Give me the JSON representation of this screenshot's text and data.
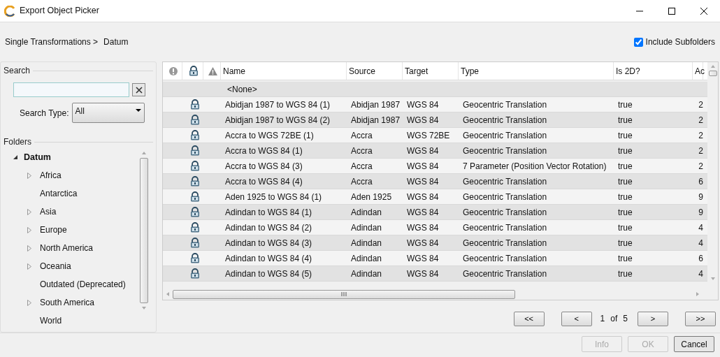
{
  "window": {
    "title": "Export Object Picker"
  },
  "breadcrumb": [
    "Single Transformations >",
    "Datum"
  ],
  "include_subfolders": {
    "label": "Include Subfolders",
    "checked": true
  },
  "search": {
    "title": "Search",
    "type_label": "Search Type:",
    "type_value": "All"
  },
  "folders": {
    "title": "Folders",
    "tree": [
      {
        "label": "Datum",
        "expanded": true,
        "children": [
          {
            "label": "Africa",
            "expandable": true
          },
          {
            "label": "Antarctica",
            "expandable": false
          },
          {
            "label": "Asia",
            "expandable": true
          },
          {
            "label": "Europe",
            "expandable": true
          },
          {
            "label": "North America",
            "expandable": true
          },
          {
            "label": "Oceania",
            "expandable": true
          },
          {
            "label": "Outdated (Deprecated)",
            "expandable": false
          },
          {
            "label": "South America",
            "expandable": true
          },
          {
            "label": "World",
            "expandable": false
          }
        ]
      }
    ]
  },
  "table": {
    "columns": [
      "Name",
      "Source",
      "Target",
      "Type",
      "Is 2D?",
      "Ac"
    ],
    "none_row": "<None>",
    "rows": [
      {
        "locked": true,
        "cells": [
          "Abidjan 1987 to WGS 84 (1)",
          "Abidjan 1987",
          "WGS 84",
          "Geocentric Translation",
          "true",
          "2"
        ]
      },
      {
        "locked": true,
        "cells": [
          "Abidjan 1987 to WGS 84 (2)",
          "Abidjan 1987",
          "WGS 84",
          "Geocentric Translation",
          "true",
          "2"
        ]
      },
      {
        "locked": true,
        "cells": [
          "Accra to WGS 72BE (1)",
          "Accra",
          "WGS 72BE",
          "Geocentric Translation",
          "true",
          "2"
        ]
      },
      {
        "locked": true,
        "cells": [
          "Accra to WGS 84 (1)",
          "Accra",
          "WGS 84",
          "Geocentric Translation",
          "true",
          "2"
        ]
      },
      {
        "locked": true,
        "cells": [
          "Accra to WGS 84 (3)",
          "Accra",
          "WGS 84",
          "7 Parameter (Position Vector Rotation)",
          "true",
          "2"
        ]
      },
      {
        "locked": true,
        "cells": [
          "Accra to WGS 84 (4)",
          "Accra",
          "WGS 84",
          "Geocentric Translation",
          "true",
          "6"
        ]
      },
      {
        "locked": true,
        "cells": [
          "Aden 1925 to WGS 84 (1)",
          "Aden 1925",
          "WGS 84",
          "Geocentric Translation",
          "true",
          "9"
        ]
      },
      {
        "locked": true,
        "cells": [
          "Adindan to WGS 84 (1)",
          "Adindan",
          "WGS 84",
          "Geocentric Translation",
          "true",
          "9"
        ]
      },
      {
        "locked": true,
        "cells": [
          "Adindan to WGS 84 (2)",
          "Adindan",
          "WGS 84",
          "Geocentric Translation",
          "true",
          "4"
        ]
      },
      {
        "locked": true,
        "cells": [
          "Adindan to WGS 84 (3)",
          "Adindan",
          "WGS 84",
          "Geocentric Translation",
          "true",
          "4"
        ]
      },
      {
        "locked": true,
        "cells": [
          "Adindan to WGS 84 (4)",
          "Adindan",
          "WGS 84",
          "Geocentric Translation",
          "true",
          "6"
        ]
      },
      {
        "locked": true,
        "cells": [
          "Adindan to WGS 84 (5)",
          "Adindan",
          "WGS 84",
          "Geocentric Translation",
          "true",
          "4"
        ]
      }
    ]
  },
  "pager": {
    "first": "<<",
    "prev": "<",
    "page": "1",
    "of": "of",
    "total": "5",
    "next": ">",
    "last": ">>"
  },
  "buttons": [
    {
      "label": "Info",
      "disabled": true
    },
    {
      "label": "OK",
      "disabled": true
    },
    {
      "label": "Cancel",
      "disabled": false
    }
  ]
}
